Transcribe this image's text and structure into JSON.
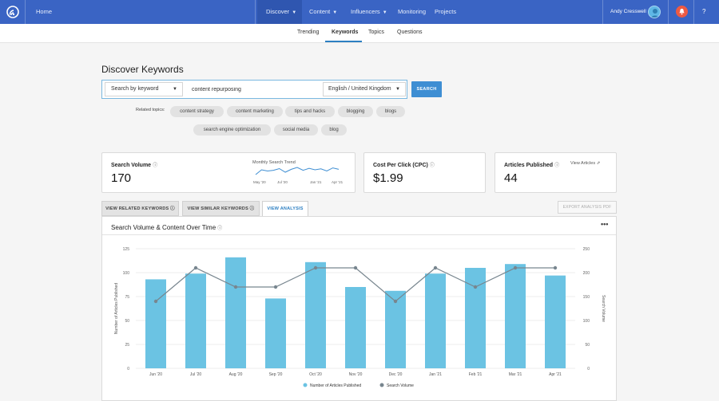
{
  "nav": {
    "home": "Home",
    "discover": "Discover",
    "content": "Content",
    "influencers": "Influencers",
    "monitoring": "Monitoring",
    "projects": "Projects",
    "user_name": "Andy Cresswell",
    "help": "?"
  },
  "subtabs": [
    "Trending",
    "Keywords",
    "Topics",
    "Questions"
  ],
  "active_subtab": "Keywords",
  "page_title": "Discover Keywords",
  "search": {
    "type": "Search by keyword",
    "query": "content repurposing",
    "language": "English / United Kingdom",
    "button": "SEARCH"
  },
  "related": {
    "label": "Related topics:",
    "topics": [
      "content strategy",
      "content marketing",
      "tips and hacks",
      "blogging",
      "blogs",
      "search engine optimization",
      "social media",
      "blog"
    ]
  },
  "metrics": {
    "search_volume_label": "Search Volume",
    "search_volume_value": "170",
    "trend_title": "Monthly Search Trend",
    "trend_ticks": [
      "May '20",
      "Jul '20",
      "Jan '21",
      "Apr '21"
    ],
    "cpc_label": "Cost Per Click (CPC)",
    "cpc_value": "$1.99",
    "articles_label": "Articles Published",
    "articles_value": "44",
    "view_articles": "View Articles"
  },
  "analysis_tabs": [
    "VIEW RELATED KEYWORDS",
    "VIEW SIMILAR KEYWORDS",
    "VIEW ANALYSIS"
  ],
  "export_label": "EXPORT ANALYSIS PDF",
  "chart": {
    "title": "Search Volume & Content Over Time",
    "more": "•••"
  },
  "chart_data": {
    "type": "bar",
    "categories": [
      "Jun '20",
      "Jul '20",
      "Aug '20",
      "Sep '20",
      "Oct '20",
      "Nov '20",
      "Dec '20",
      "Jan '21",
      "Feb '21",
      "Mar '21",
      "Apr '21"
    ],
    "series": [
      {
        "name": "Number of Articles Published",
        "type": "bar",
        "axis": "left",
        "color": "#6bc3e3",
        "values": [
          93,
          99,
          116,
          73,
          111,
          85,
          81,
          99,
          105,
          109,
          97
        ]
      },
      {
        "name": "Search Volume",
        "type": "line",
        "axis": "right",
        "color": "#78868f",
        "values": [
          140,
          210,
          170,
          170,
          210,
          210,
          140,
          210,
          170,
          210,
          210
        ]
      }
    ],
    "ylabel_left": "Number of Articles Published",
    "ylabel_right": "Search Volume",
    "ylim_left": [
      0,
      125
    ],
    "yticks_left": [
      "0",
      "25",
      "50",
      "75",
      "100",
      "125"
    ],
    "ylim_right": [
      0,
      250
    ],
    "yticks_right": [
      "0",
      "50",
      "100",
      "150",
      "200",
      "250"
    ],
    "legend_position": "bottom",
    "grid": true
  },
  "trend_data": [
    150,
    170,
    165,
    168,
    175,
    160,
    172,
    180,
    168,
    176,
    170,
    174,
    165,
    178,
    172
  ]
}
